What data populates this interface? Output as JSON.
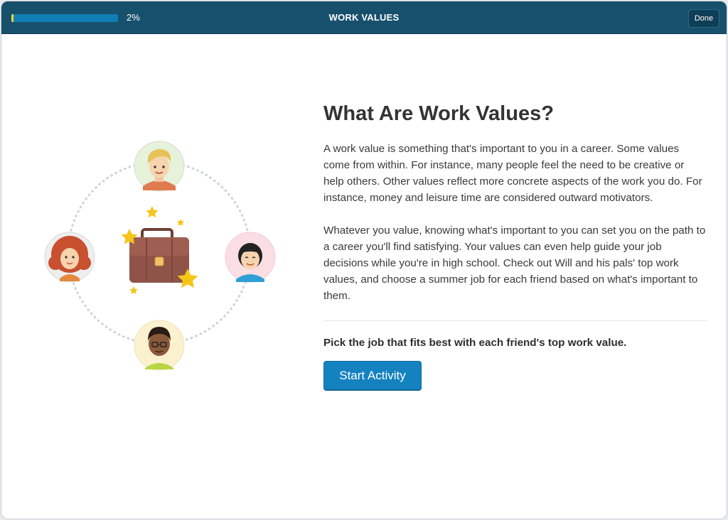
{
  "header": {
    "title": "WORK VALUES",
    "progress_percent": 2,
    "progress_label": "2%",
    "done_label": "Done"
  },
  "illustration": {
    "center_icon": "briefcase-icon",
    "avatars": [
      "blond-boy-avatar",
      "curly-red-hair-girl-avatar",
      "dark-hair-girl-avatar",
      "boy-with-glasses-avatar"
    ],
    "accent_colors": {
      "star": "#f5c518",
      "briefcase": "#8f5447",
      "ring": "#cfd3d6"
    }
  },
  "main": {
    "heading": "What Are Work Values?",
    "paragraph1": "A work value is something that's important to you in a career. Some values come from within. For instance, many people feel the need to be creative or help others. Other values reflect more concrete aspects of the work you do. For instance, money and leisure time are considered outward motivators.",
    "paragraph2": "Whatever you value, knowing what's important to you can set you on the path to a career you'll find satisfying. Your values can even help guide your job decisions while you're in high school. Check out Will and his pals' top work values, and choose a summer job for each friend based on what's important to them.",
    "instruction": "Pick the job that fits best with each friend's top work value.",
    "start_button_label": "Start Activity"
  },
  "colors": {
    "header_bg": "#17506d",
    "button_bg": "#1482bf",
    "progress_fill": "#f2d43b"
  }
}
